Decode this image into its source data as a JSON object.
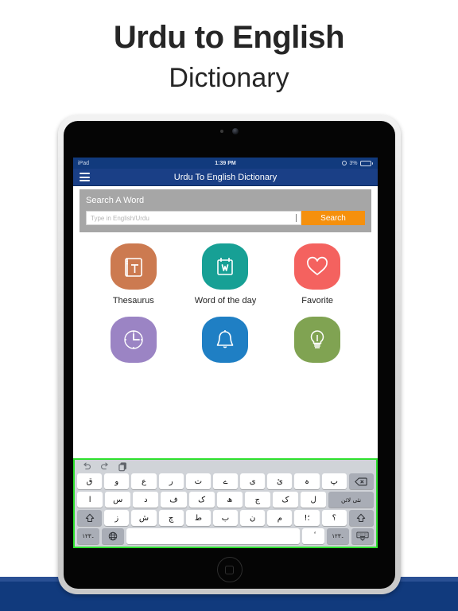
{
  "heading": {
    "line1": "Urdu to English",
    "line2": "Dictionary"
  },
  "device": {
    "type": "ipad",
    "home_button": "home-button"
  },
  "statusbar": {
    "carrier": "iPad",
    "time": "1:39 PM",
    "battery_percent": "3%",
    "location_icon": "location-icon",
    "battery_icon": "battery-icon"
  },
  "navbar": {
    "menu_icon": "hamburger-menu-icon",
    "title": "Urdu To English Dictionary",
    "background_color": "#1a3f86"
  },
  "search": {
    "title": "Search A Word",
    "placeholder": "Type in English/Urdu",
    "value": "",
    "button_label": "Search",
    "button_color": "#f5900d",
    "panel_color": "#a6a6a6"
  },
  "grid": {
    "tiles": [
      {
        "label": "Thesaurus",
        "icon": "book-icon",
        "color": "#cc7a50"
      },
      {
        "label": "Word of the day",
        "icon": "calendar-w-icon",
        "color": "#17a095"
      },
      {
        "label": "Favorite",
        "icon": "heart-icon",
        "color": "#f4625f"
      },
      {
        "label": "",
        "icon": "clock-icon",
        "color": "#9b84c4"
      },
      {
        "label": "",
        "icon": "bell-icon",
        "color": "#1f7fc4"
      },
      {
        "label": "",
        "icon": "bulb-icon",
        "color": "#80a352"
      }
    ]
  },
  "keyboard": {
    "highlight_color": "#2ee02e",
    "toolbar": [
      {
        "name": "undo-icon",
        "label": "undo"
      },
      {
        "name": "redo-icon",
        "label": "redo"
      },
      {
        "name": "copy-icon",
        "label": "copy"
      }
    ],
    "row1": [
      "ق",
      "و",
      "ع",
      "ر",
      "ت",
      "ے",
      "ی",
      "ئ",
      "ہ",
      "پ"
    ],
    "row1_action": "backspace-icon",
    "row2": [
      "ا",
      "س",
      "د",
      "ف",
      "ک",
      "ھ",
      "ج",
      "ک",
      "ل"
    ],
    "row2_action": "نئی لائن",
    "row3_shift_left": "shift-icon",
    "row3": [
      "ز",
      "ش",
      "چ",
      "ط",
      "ب",
      "ن",
      "م",
      "!؛",
      "؟"
    ],
    "row3_shift_right": "shift-icon",
    "row4": {
      "numbers_left": "۱۲۳۔",
      "globe": "globe-icon",
      "space": "",
      "diacritic": "ٔ",
      "numbers_right": "۱۲۳۔",
      "dismiss": "keyboard-dismiss-icon"
    }
  },
  "bottom_band": {
    "color": "#113a7d",
    "accent": "#2a5094"
  }
}
